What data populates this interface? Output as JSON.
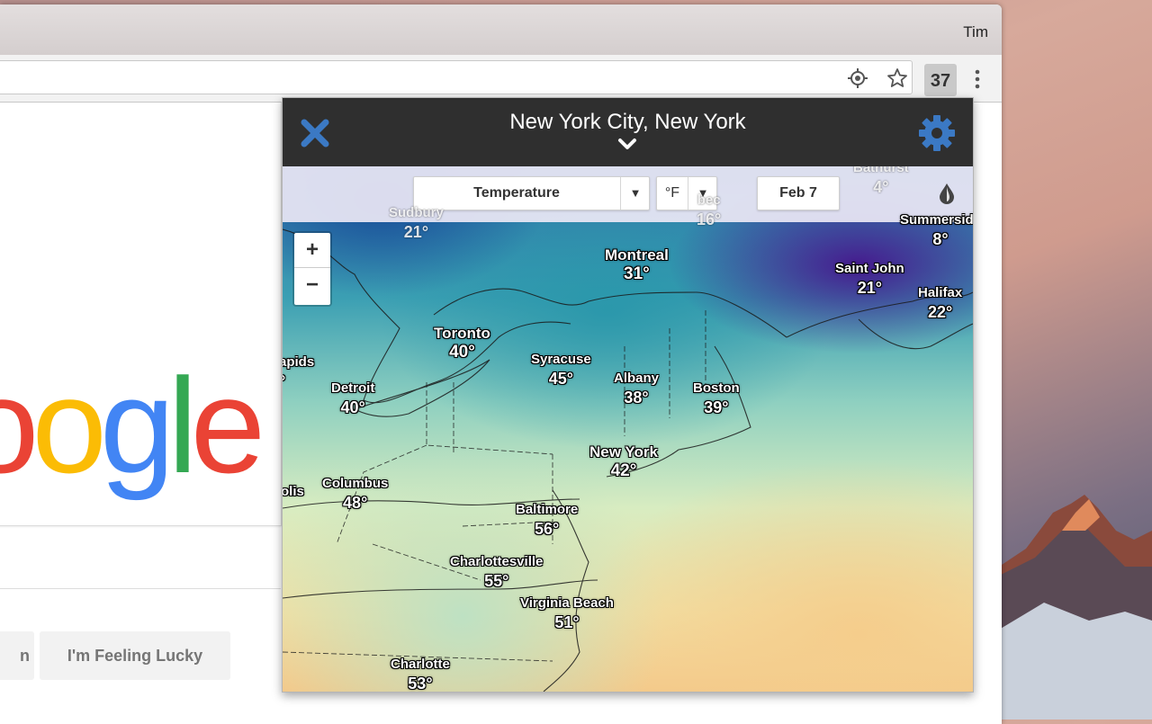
{
  "browser": {
    "profile_name": "Tim",
    "extension_badge": "37"
  },
  "google": {
    "logo_text": "oogle",
    "lucky_button": "I'm Feeling Lucky",
    "search_button_partial": "n",
    "colors": {
      "blue": "#4285f4",
      "red": "#ea4335",
      "yellow": "#fbbc05",
      "green": "#34a853"
    }
  },
  "popup": {
    "location": "New York City, New York",
    "layer_select": "Temperature",
    "unit_select": "°F",
    "date": "Feb 7",
    "accent_color": "#3b79c4",
    "header_color": "#2f2f2f"
  },
  "map": {
    "zoom_in": "+",
    "zoom_out": "−",
    "cities": [
      {
        "name": "Sudbury",
        "temp": "21°"
      },
      {
        "name": "Bathurst",
        "temp": "4°"
      },
      {
        "name": "bec",
        "temp": "16°"
      },
      {
        "name": "Summerside",
        "temp": "8°"
      },
      {
        "name": "Montreal",
        "temp": "31°"
      },
      {
        "name": "Saint John",
        "temp": "21°"
      },
      {
        "name": "Halifax",
        "temp": "22°"
      },
      {
        "name": "Toronto",
        "temp": "40°"
      },
      {
        "name": "apids",
        "temp": "°"
      },
      {
        "name": "Syracuse",
        "temp": "45°"
      },
      {
        "name": "Albany",
        "temp": "38°"
      },
      {
        "name": "Boston",
        "temp": "39°"
      },
      {
        "name": "Detroit",
        "temp": "40°"
      },
      {
        "name": "New York",
        "temp": "42°"
      },
      {
        "name": "Columbus",
        "temp": "48°"
      },
      {
        "name": "olis",
        "temp": ""
      },
      {
        "name": "Baltimore",
        "temp": "56°"
      },
      {
        "name": "Charlottesville",
        "temp": "55°"
      },
      {
        "name": "Virginia Beach",
        "temp": "51°"
      },
      {
        "name": "Charlotte",
        "temp": "53°"
      }
    ]
  }
}
